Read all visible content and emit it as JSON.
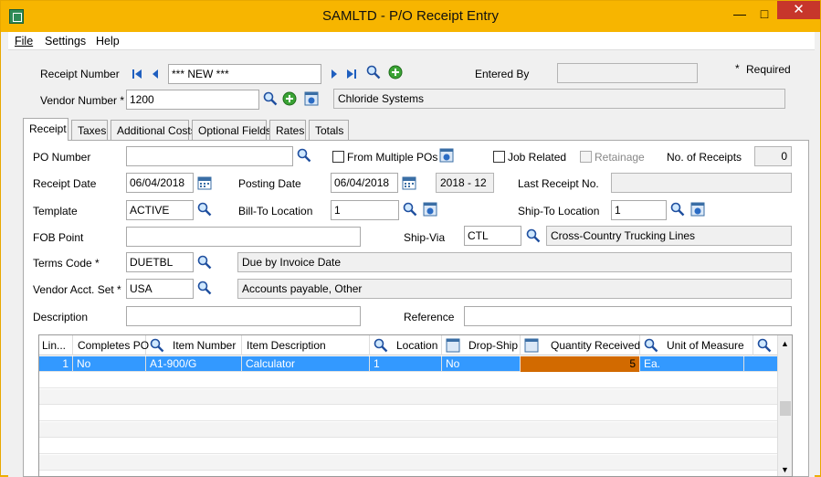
{
  "window": {
    "title": "SAMLTD - P/O Receipt Entry",
    "minimize": "—",
    "maximize": "□",
    "close": "✕"
  },
  "menu": {
    "file": "File",
    "settings": "Settings",
    "help": "Help"
  },
  "header": {
    "receipt_number_label": "Receipt Number",
    "receipt_number_value": "*** NEW ***",
    "entered_by_label": "Entered By",
    "entered_by_value": "",
    "required_label": "Required",
    "required_marker": "*",
    "vendor_number_label": "Vendor Number *",
    "vendor_number_value": "1200",
    "vendor_name": "Chloride Systems"
  },
  "tabs": [
    "Receipt",
    "Taxes",
    "Additional Costs",
    "Optional Fields",
    "Rates",
    "Totals"
  ],
  "receipt": {
    "po_number_label": "PO Number",
    "po_number_value": "",
    "from_multiple_pos_label": "From Multiple POs",
    "job_related_label": "Job Related",
    "retainage_label": "Retainage",
    "no_of_receipts_label": "No. of Receipts",
    "no_of_receipts_value": "0",
    "receipt_date_label": "Receipt Date",
    "receipt_date_value": "06/04/2018",
    "posting_date_label": "Posting Date",
    "posting_date_value": "06/04/2018",
    "period_value": "2018 - 12",
    "last_receipt_no_label": "Last Receipt No.",
    "last_receipt_no_value": "",
    "template_label": "Template",
    "template_value": "ACTIVE",
    "bill_to_location_label": "Bill-To Location",
    "bill_to_location_value": "1",
    "ship_to_location_label": "Ship-To Location",
    "ship_to_location_value": "1",
    "fob_point_label": "FOB Point",
    "fob_point_value": "",
    "ship_via_label": "Ship-Via",
    "ship_via_value": "CTL",
    "ship_via_desc": "Cross-Country Trucking Lines",
    "terms_code_label": "Terms Code *",
    "terms_code_value": "DUETBL",
    "terms_desc": "Due by Invoice Date",
    "vendor_acct_set_label": "Vendor Acct. Set *",
    "vendor_acct_set_value": "USA",
    "vendor_acct_set_desc": "Accounts payable, Other",
    "description_label": "Description",
    "description_value": "",
    "reference_label": "Reference",
    "reference_value": ""
  },
  "grid": {
    "columns": [
      "Lin...",
      "Completes PO",
      "Item Number",
      "Item Description",
      "Location",
      "Drop-Ship",
      "Quantity Received",
      "Unit of Measure"
    ],
    "rows": [
      {
        "line": "1",
        "completes_po": "No",
        "item_number": "A1-900/G",
        "item_description": "Calculator",
        "location": "1",
        "drop_ship": "No",
        "quantity_received": "5",
        "unit_of_measure": "Ea."
      }
    ]
  },
  "colors": {
    "title_bar": "#f7b500",
    "selection": "#3399ff",
    "quantity_cell": "#d26a00",
    "close_button": "#c7362b"
  },
  "icons": [
    "app-icon",
    "first-icon",
    "previous-icon",
    "next-icon",
    "last-icon",
    "zoom-icon",
    "new-icon",
    "calendar-icon",
    "info-icon"
  ]
}
